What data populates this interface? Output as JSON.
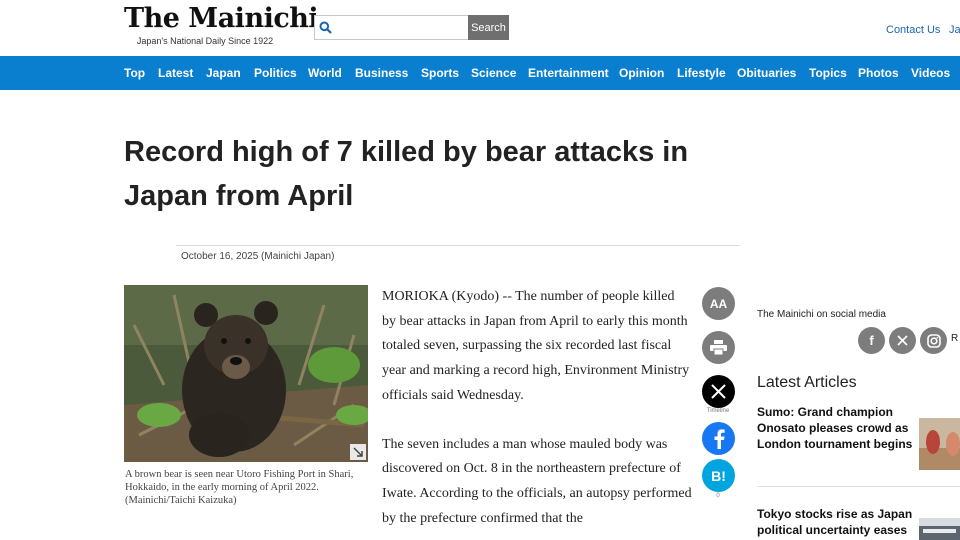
{
  "header": {
    "logo_title": "The Mainichi",
    "logo_tagline": "Japan's National Daily Since 1922",
    "search_placeholder": "",
    "search_button": "Search",
    "contact_link": "Contact Us",
    "language_link": "Ja"
  },
  "nav": {
    "items": [
      {
        "label": "Top"
      },
      {
        "label": "Latest"
      },
      {
        "label": "Japan"
      },
      {
        "label": "Politics"
      },
      {
        "label": "World"
      },
      {
        "label": "Business"
      },
      {
        "label": "Sports"
      },
      {
        "label": "Science"
      },
      {
        "label": "Entertainment"
      },
      {
        "label": "Opinion"
      },
      {
        "label": "Lifestyle"
      },
      {
        "label": "Obituaries"
      },
      {
        "label": "Topics"
      },
      {
        "label": "Photos"
      },
      {
        "label": "Videos"
      }
    ]
  },
  "article": {
    "headline": "Record high of 7 killed by bear attacks in Japan from April",
    "dateline": "October 16, 2025 (Mainichi Japan)",
    "photo_caption": "A brown bear is seen near Utoro Fishing Port in Shari, Hokkaido, in the early morning of April 2022. (Mainichi/Taichi Kaizuka)",
    "paragraphs": [
      "MORIOKA (Kyodo) -- The number of people killed by bear attacks in Japan from April to early this month totaled seven, surpassing the six recorded last fiscal year and marking a record high, Environment Ministry officials said Wednesday.",
      "The seven includes a man whose mauled body was discovered on Oct. 8 in the northeastern prefecture of Iwate. According to the officials, an autopsy performed by the prefecture confirmed that the"
    ]
  },
  "share": {
    "font_size_label": "AA",
    "timeline_label": "Timeline",
    "x_count": "",
    "hatena_label": "B!",
    "hatena_count": "0",
    "colors": {
      "x": "#000000",
      "facebook": "#1877f2",
      "hatena": "#00a4de",
      "gray": "#7d7d7d"
    }
  },
  "sidebar": {
    "social_title": "The Mainichi on social media",
    "social_icons": [
      "facebook-icon",
      "x-icon",
      "instagram-icon"
    ],
    "rss_label": "R",
    "latest_title": "Latest Articles",
    "latest_articles": [
      {
        "title": "Sumo: Grand champion Onosato pleases crowd as London tournament begins"
      },
      {
        "title": "Tokyo stocks rise as Japan political uncertainty eases"
      }
    ]
  },
  "theme": {
    "nav_blue": "#0a7fd0",
    "link_blue": "#1a66b3"
  }
}
